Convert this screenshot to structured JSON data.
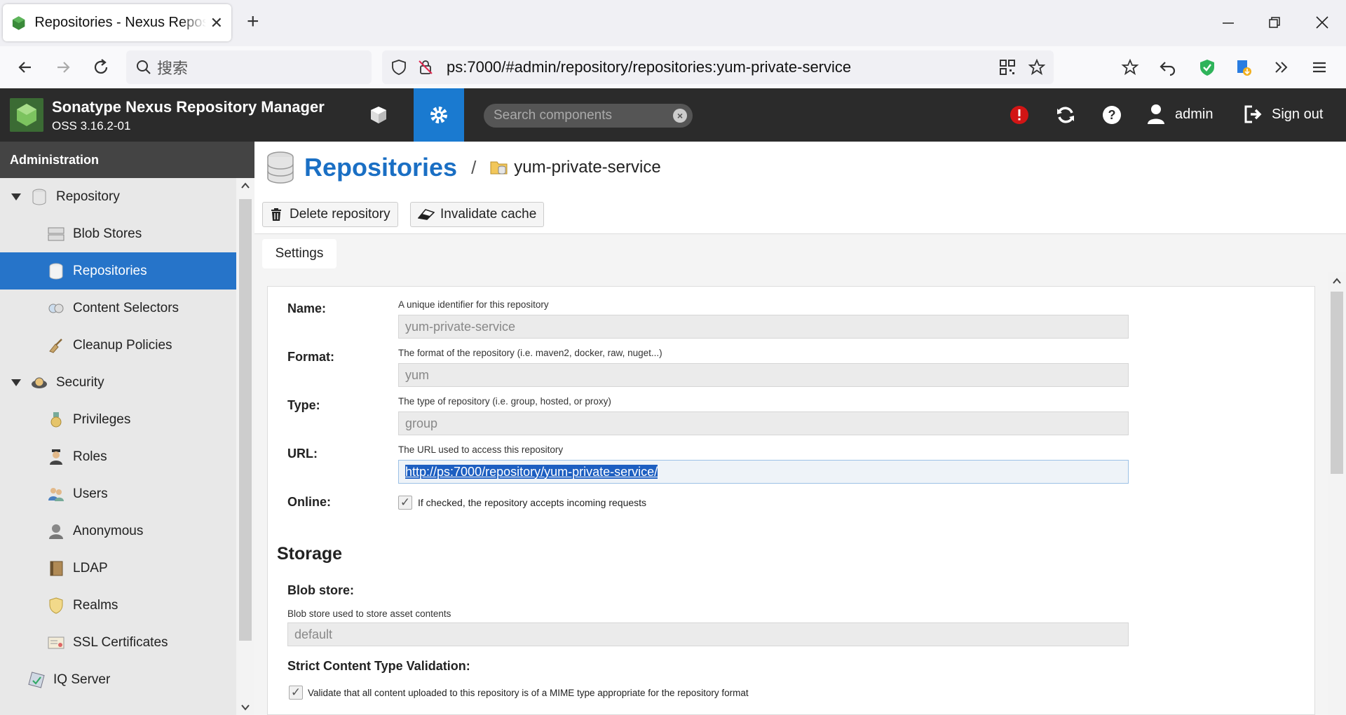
{
  "browser": {
    "tab_title": "Repositories - Nexus Repository Manager",
    "tab_close": "✕",
    "new_tab": "+",
    "search_placeholder": "搜索",
    "url": "ps:7000/#admin/repository/repositories:yum-private-service"
  },
  "header": {
    "brand": "Sonatype Nexus Repository Manager",
    "version": "OSS 3.16.2-01",
    "search_placeholder": "Search components",
    "user": "admin",
    "signout": "Sign out"
  },
  "sidebar": {
    "title": "Administration",
    "items": [
      {
        "label": "Repository",
        "level": 0,
        "icon": "database-icon"
      },
      {
        "label": "Blob Stores",
        "level": 1,
        "icon": "server-icon"
      },
      {
        "label": "Repositories",
        "level": 1,
        "icon": "database-icon",
        "selected": true
      },
      {
        "label": "Content Selectors",
        "level": 1,
        "icon": "selector-icon"
      },
      {
        "label": "Cleanup Policies",
        "level": 1,
        "icon": "broom-icon"
      },
      {
        "label": "Security",
        "level": 0,
        "icon": "security-icon"
      },
      {
        "label": "Privileges",
        "level": 1,
        "icon": "medal-icon"
      },
      {
        "label": "Roles",
        "level": 1,
        "icon": "role-icon"
      },
      {
        "label": "Users",
        "level": 1,
        "icon": "users-icon"
      },
      {
        "label": "Anonymous",
        "level": 1,
        "icon": "anonymous-icon"
      },
      {
        "label": "LDAP",
        "level": 1,
        "icon": "book-icon"
      },
      {
        "label": "Realms",
        "level": 1,
        "icon": "shield-icon"
      },
      {
        "label": "SSL Certificates",
        "level": 1,
        "icon": "certificate-icon"
      },
      {
        "label": "IQ Server",
        "level": 0,
        "icon": "iq-icon"
      }
    ]
  },
  "breadcrumb": {
    "title": "Repositories",
    "separator": "/",
    "current": "yum-private-service"
  },
  "toolbar": {
    "delete_label": "Delete repository",
    "invalidate_label": "Invalidate cache"
  },
  "tabs": {
    "settings": "Settings"
  },
  "form": {
    "name": {
      "label": "Name:",
      "help": "A unique identifier for this repository",
      "value": "yum-private-service"
    },
    "format": {
      "label": "Format:",
      "help": "The format of the repository (i.e. maven2, docker, raw, nuget...)",
      "value": "yum"
    },
    "type": {
      "label": "Type:",
      "help": "The type of repository (i.e. group, hosted, or proxy)",
      "value": "group"
    },
    "url": {
      "label": "URL:",
      "help": "The URL used to access this repository",
      "value": "http://ps:7000/repository/yum-private-service/"
    },
    "online": {
      "label": "Online:",
      "help": "If checked, the repository accepts incoming requests",
      "checked": true
    },
    "storage": {
      "title": "Storage",
      "blob_label": "Blob store:",
      "blob_help": "Blob store used to store asset contents",
      "blob_value": "default",
      "strict_label": "Strict Content Type Validation:",
      "strict_help": "Validate that all content uploaded to this repository is of a MIME type appropriate for the repository format",
      "strict_checked": true
    }
  }
}
